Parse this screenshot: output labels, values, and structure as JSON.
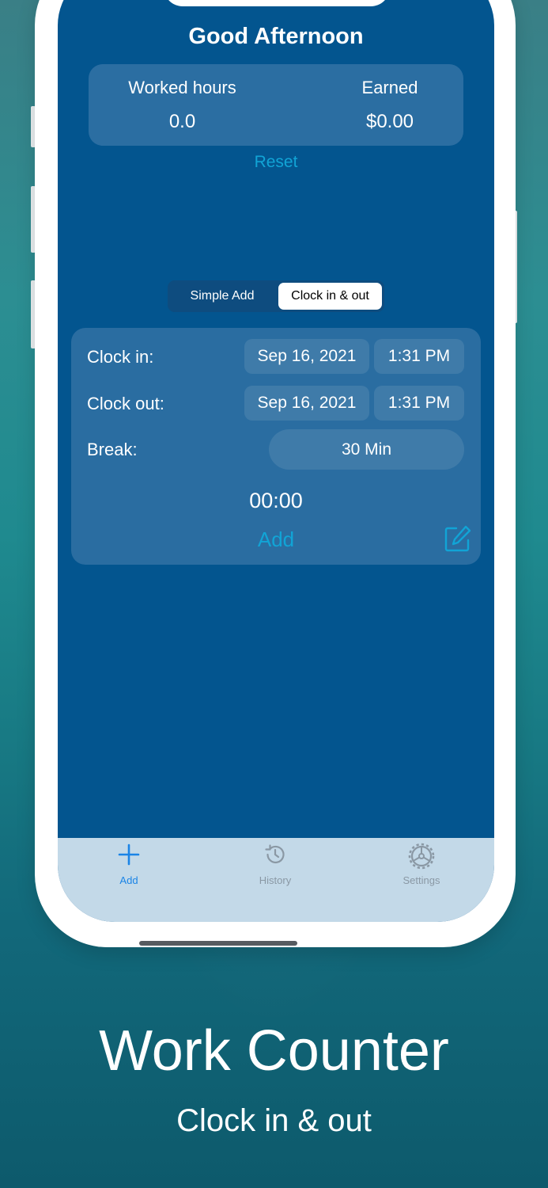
{
  "screen": {
    "greeting": "Good Afternoon",
    "summary": {
      "worked_label": "Worked hours",
      "worked_value": "0.0",
      "earned_label": "Earned",
      "earned_value": "$0.00"
    },
    "reset_label": "Reset",
    "segmented": {
      "options": [
        "Simple Add",
        "Clock in & out"
      ],
      "selected": "Clock in & out"
    },
    "form": {
      "clock_in_label": "Clock in:",
      "clock_in_date": "Sep 16, 2021",
      "clock_in_time": "1:31 PM",
      "clock_out_label": "Clock out:",
      "clock_out_date": "Sep 16, 2021",
      "clock_out_time": "1:31 PM",
      "break_label": "Break:",
      "break_value": "30 Min",
      "timer": "00:00",
      "add_label": "Add",
      "edit_icon": "edit-icon"
    },
    "tabbar": {
      "items": [
        {
          "label": "Add",
          "icon": "plus-icon",
          "active": true
        },
        {
          "label": "History",
          "icon": "history-icon",
          "active": false
        },
        {
          "label": "Settings",
          "icon": "gear-icon",
          "active": false
        }
      ]
    }
  },
  "promo": {
    "title": "Work Counter",
    "subtitle": "Clock in & out"
  },
  "colors": {
    "screen_bg": "#03558f",
    "card_bg": "#2a6da1",
    "accent": "#11a4d6",
    "tab_active": "#1a84e6",
    "tabbar_bg": "#c3d9e8"
  }
}
